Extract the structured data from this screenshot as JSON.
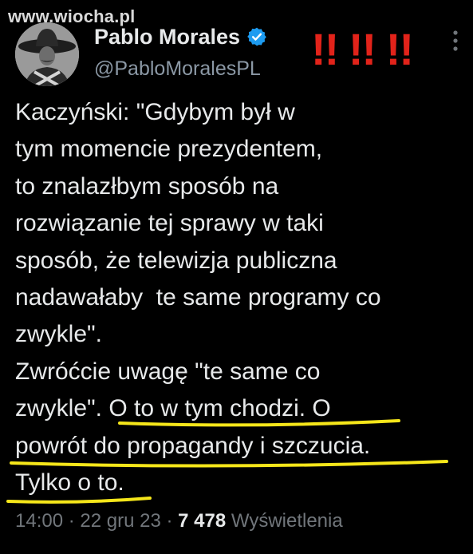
{
  "watermark": "www.wiocha.pl",
  "author": {
    "display_name": "Pablo Morales",
    "handle": "@PabloMoralesPL",
    "verified": true,
    "verified_color": "#1d9bf0",
    "avatar_icon": "avatar-portrait"
  },
  "annotation": {
    "marks": "!! !! !!",
    "color": "#e2231a"
  },
  "more_icon": "ellipsis-vertical-icon",
  "tweet": {
    "lines": [
      "Kaczyński: \"Gdybym był w",
      "tym momencie prezydentem,",
      "to znalazłbym sposób na",
      "rozwiązanie tej sprawy w taki",
      "sposób, że telewizja publiczna",
      "nadawałaby  te same programy co",
      "zwykle\".",
      "Zwróćcie uwagę \"te same co",
      "zwykle\". O to w tym chodzi. O",
      "powrót do propagandy i szczucia.",
      "Tylko o to."
    ],
    "highlight_color": "#f5e61a"
  },
  "meta": {
    "time": "14:00",
    "separator": " · ",
    "date": "22 gru 23",
    "views_count": "7 478",
    "views_label": "Wyświetlenia"
  },
  "colors": {
    "background": "#000000",
    "primary_text": "#e7e9ea",
    "secondary_text": "#71767b"
  }
}
